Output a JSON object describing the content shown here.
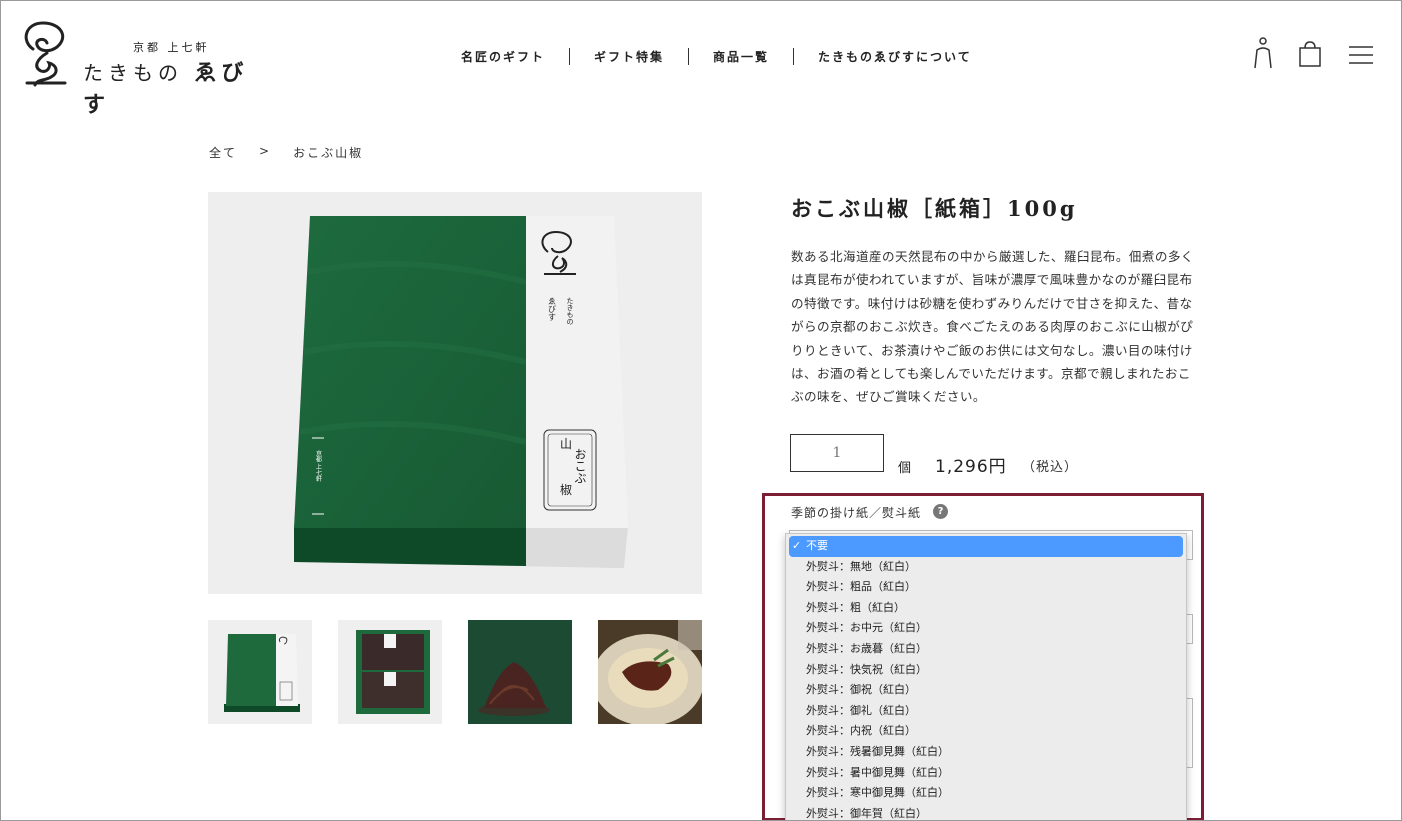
{
  "header": {
    "logo_sub": "京都 上七軒",
    "logo_name_a": "たきもの",
    "logo_name_b": "ゑびす",
    "nav": [
      "名匠のギフト",
      "ギフト特集",
      "商品一覧",
      "たきものゑびすについて"
    ],
    "icons": [
      "user-icon",
      "cart-icon",
      "menu-icon"
    ]
  },
  "breadcrumb": [
    "全て",
    ">",
    "おこぶ山椒"
  ],
  "product": {
    "title": "おこぶ山椒［紙箱］100g",
    "description": "数ある北海道産の天然昆布の中から厳選した、羅臼昆布。佃煮の多くは真昆布が使われていますが、旨味が濃厚で風味豊かなのが羅臼昆布の特徴です。味付けは砂糖を使わずみりんだけで甘さを抑えた、昔ながらの京都のおこぶ炊き。食べごたえのある肉厚のおこぶに山椒がぴりりときいて、お茶漬けやご飯のお供には文句なし。濃い目の味付けは、お酒の肴としても楽しんでいただけます。京都で親しまれたおこぶの味を、ぜひご賞味ください。",
    "quantity": "1",
    "unit": "個",
    "price": "1,296円",
    "tax": "（税込）",
    "package_text": {
      "brand_small": "たきもの",
      "brand_name": "ゑびす",
      "item_col1": "山",
      "item_col1b": "椒",
      "item_col2": "おこぶ",
      "side_text": "京都 上七軒"
    }
  },
  "noshi": {
    "label": "季節の掛け紙／熨斗紙",
    "help": "?",
    "selected_mark": "✓",
    "options": [
      "不要",
      "外熨斗：無地（紅白）",
      "外熨斗：粗品（紅白）",
      "外熨斗：粗（紅白）",
      "外熨斗：お中元（紅白）",
      "外熨斗：お歳暮（紅白）",
      "外熨斗：快気祝（紅白）",
      "外熨斗：御祝（紅白）",
      "外熨斗：御礼（紅白）",
      "外熨斗：内祝（紅白）",
      "外熨斗：残暑御見舞（紅白）",
      "外熨斗：暑中御見舞（紅白）",
      "外熨斗：寒中御見舞（紅白）",
      "外熨斗：御年賀（紅白）"
    ]
  },
  "colors": {
    "highlight": "#7d1f33",
    "selected": "#4c9aff",
    "box_green": "#1f6a3d"
  }
}
